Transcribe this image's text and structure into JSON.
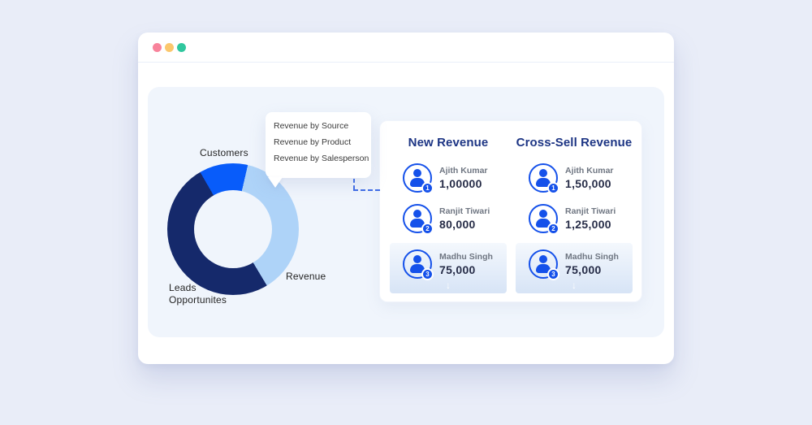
{
  "titlebar": {
    "dot_colors": {
      "close": "#F8839B",
      "minimize": "#FBC76C",
      "maximize": "#30C79E"
    }
  },
  "chart": {
    "labels": {
      "customers": "Customers",
      "revenue": "Revenue",
      "leads_line1": "Leads",
      "leads_line2": "Opportunites"
    }
  },
  "chart_data": {
    "type": "pie",
    "donut": true,
    "title": "",
    "start_angle_deg": -30,
    "segments": [
      {
        "label": "Customers",
        "percent": 12,
        "color": "#085CFA"
      },
      {
        "label": "Revenue",
        "percent": 38,
        "color": "#AED3F8"
      },
      {
        "label": "Leads Opportunites",
        "percent": 50,
        "color": "#15296B"
      }
    ],
    "legend_position": "around-chart"
  },
  "tooltip": {
    "items": [
      {
        "label": "Revenue by Source"
      },
      {
        "label": "Revenue by Product"
      },
      {
        "label": "Revenue by Salesperson"
      }
    ]
  },
  "card": {
    "columns": [
      {
        "title": "New Revenue",
        "rows": [
          {
            "rank": "1",
            "name": "Ajith Kumar",
            "value": "1,00000"
          },
          {
            "rank": "2",
            "name": "Ranjit Tiwari",
            "value": "80,000"
          },
          {
            "rank": "3",
            "name": "Madhu Singh",
            "value": "75,000"
          }
        ]
      },
      {
        "title": "Cross-Sell Revenue",
        "rows": [
          {
            "rank": "1",
            "name": "Ajith Kumar",
            "value": "1,50,000"
          },
          {
            "rank": "2",
            "name": "Ranjit Tiwari",
            "value": "1,25,000"
          },
          {
            "rank": "3",
            "name": "Madhu Singh",
            "value": "75,000"
          }
        ]
      }
    ]
  },
  "icons": {
    "arrow_down": "↓"
  },
  "colors": {
    "page_bg": "#E9EDF8",
    "panel_bg": "#F0F5FC",
    "accent_blue": "#1551EA",
    "header_navy": "#1D3584",
    "donut_navy": "#15296B",
    "donut_bright_blue": "#085CFA",
    "donut_light_blue": "#AED3F8",
    "dashed_connector": "#3F6CE6",
    "highlight_row_gradient_top": "#F4F8FD",
    "highlight_row_gradient_bottom": "#D7E4F6"
  }
}
